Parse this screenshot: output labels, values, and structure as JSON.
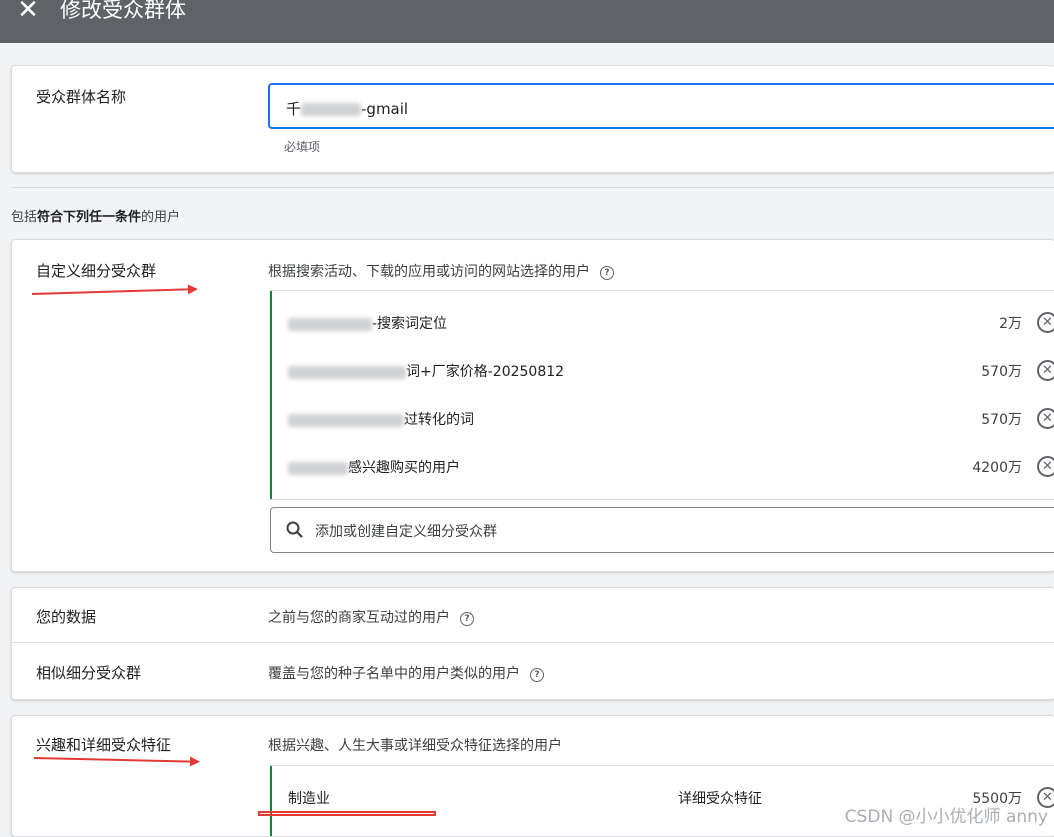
{
  "header": {
    "close_icon": "close-icon",
    "title": "修改受众群体"
  },
  "name_section": {
    "label": "受众群体名称",
    "input_value_prefix": "千",
    "input_value_suffix": "-gmail",
    "helper": "必填项"
  },
  "criteria": {
    "prefix": "包括",
    "bold": "符合下列任一条件",
    "suffix": "的用户"
  },
  "custom_segments": {
    "label": "自定义细分受众群",
    "description": "根据搜索活动、下载的应用或访问的网站选择的用户",
    "items": [
      {
        "label": "-搜索词定位",
        "size": "2万"
      },
      {
        "label": "词+厂家价格-20250812",
        "size": "570万"
      },
      {
        "label": "过转化的词",
        "size": "570万"
      },
      {
        "label": "感兴趣购买的用户",
        "size": "4200万"
      }
    ],
    "search_placeholder": "添加或创建自定义细分受众群"
  },
  "your_data": {
    "label": "您的数据",
    "description": "之前与您的商家互动过的用户"
  },
  "similar": {
    "label": "相似细分受众群",
    "description": "覆盖与您的种子名单中的用户类似的用户"
  },
  "interests": {
    "label": "兴趣和详细受众特征",
    "description": "根据兴趣、人生大事或详细受众特征选择的用户",
    "items": [
      {
        "label": "制造业",
        "type": "详细受众特征",
        "size": "5500万"
      }
    ]
  },
  "watermark": "CSDN @小小优化师 anny",
  "colors": {
    "accent": "#1a73e8",
    "included_bar": "#188038",
    "annotation": "#e53935",
    "header_bg": "#5f6368"
  }
}
